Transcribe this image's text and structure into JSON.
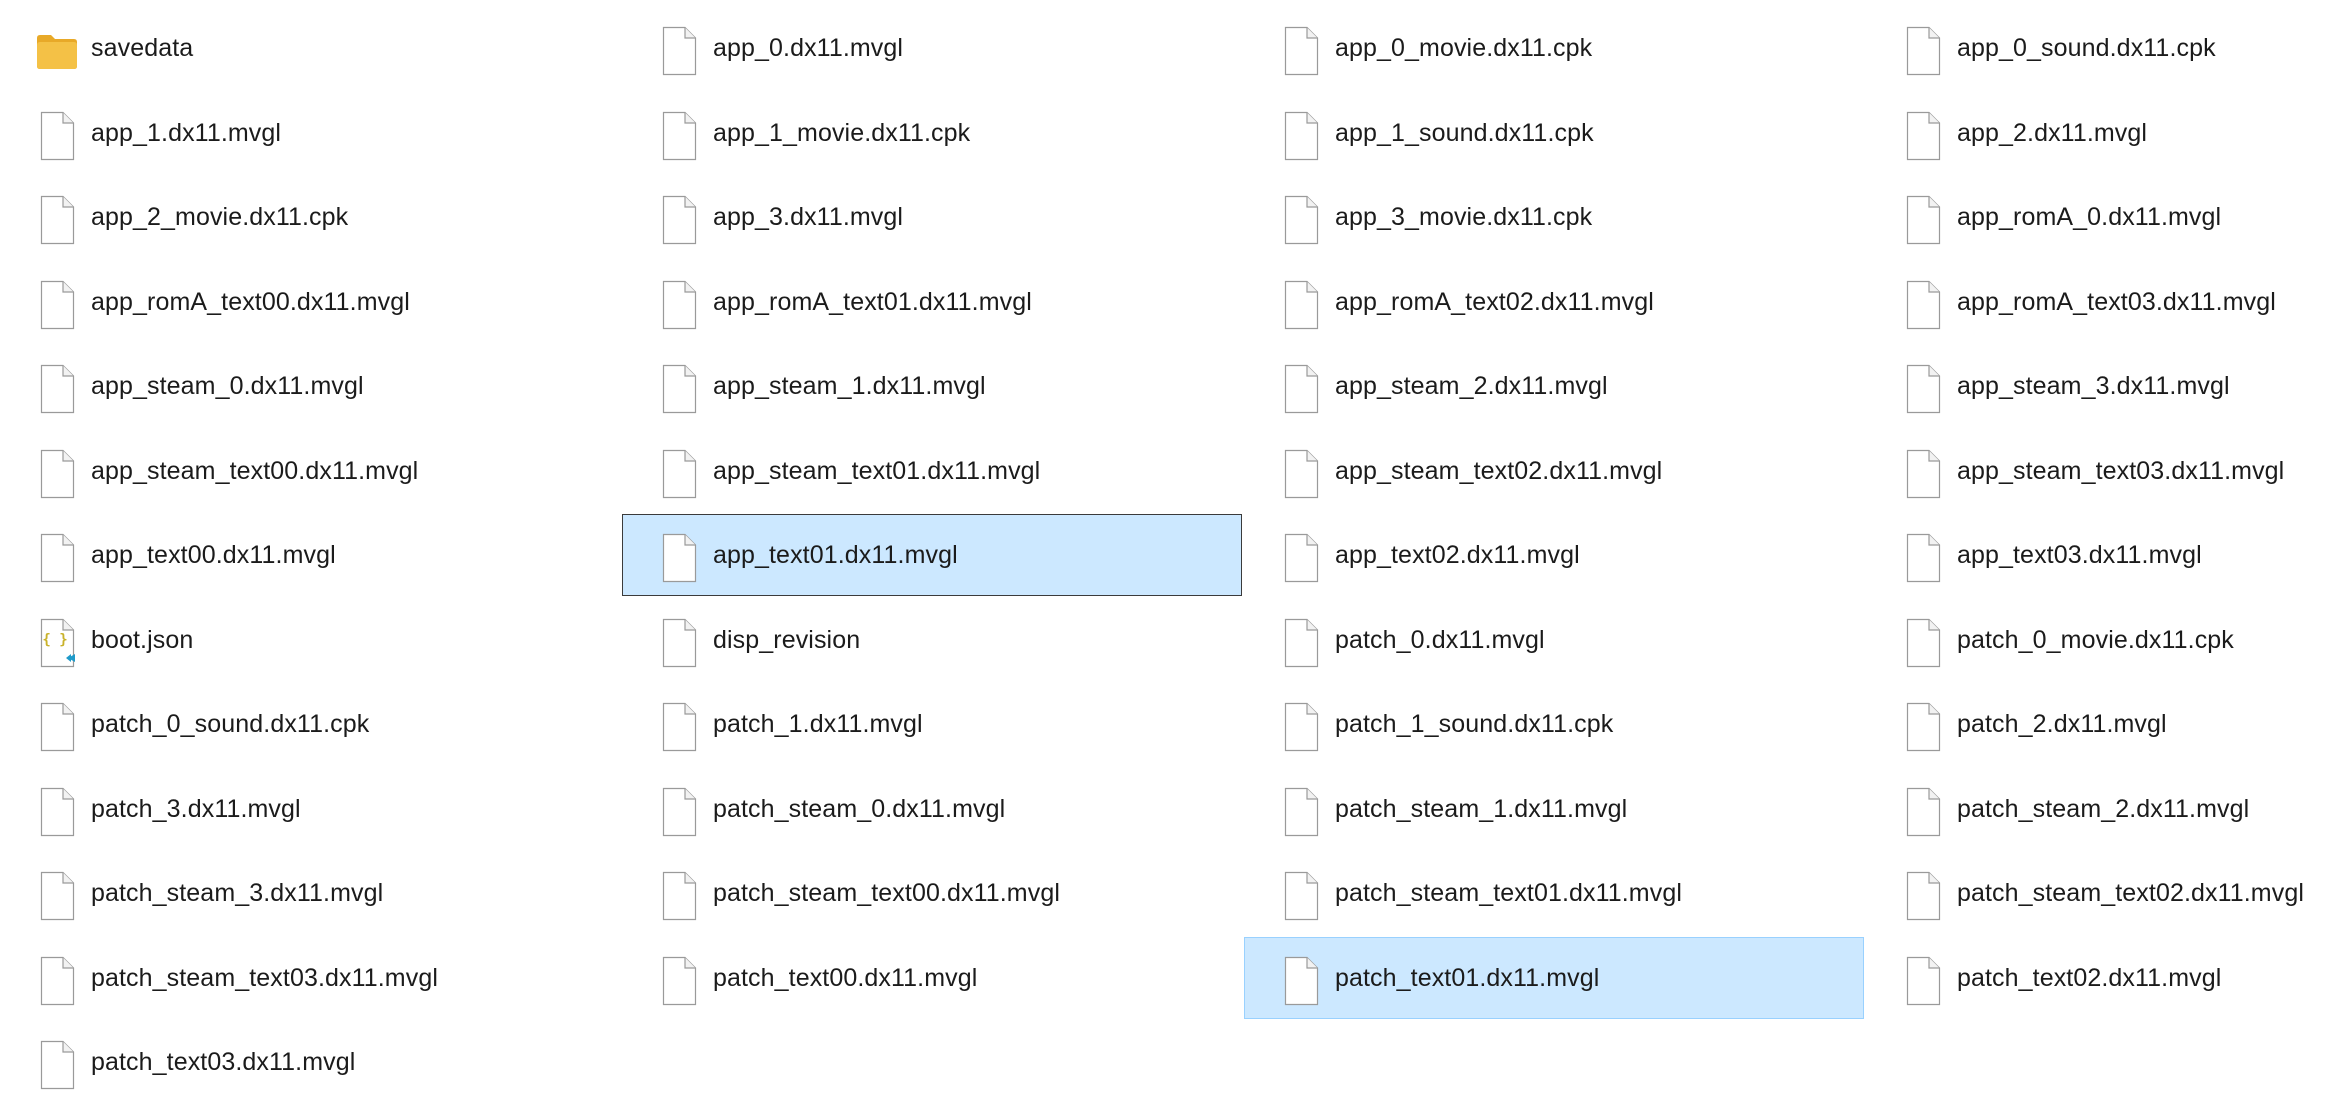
{
  "window": {
    "view": "Large icons",
    "colors": {
      "selection_fill": "#cce8ff",
      "selection_border_focused": "#3b3b3b",
      "selection_border_unfocused": "#99d1ff",
      "folder": "#f4c146",
      "json_braces": "#c9b22a",
      "json_badge": "#1f9ac9"
    }
  },
  "files": [
    {
      "name": "savedata",
      "icon": "folder-icon"
    },
    {
      "name": "app_0.dx11.mvgl",
      "icon": "file-icon"
    },
    {
      "name": "app_0_movie.dx11.cpk",
      "icon": "file-icon"
    },
    {
      "name": "app_0_sound.dx11.cpk",
      "icon": "file-icon"
    },
    {
      "name": "app_1.dx11.mvgl",
      "icon": "file-icon"
    },
    {
      "name": "app_1_movie.dx11.cpk",
      "icon": "file-icon"
    },
    {
      "name": "app_1_sound.dx11.cpk",
      "icon": "file-icon"
    },
    {
      "name": "app_2.dx11.mvgl",
      "icon": "file-icon"
    },
    {
      "name": "app_2_movie.dx11.cpk",
      "icon": "file-icon"
    },
    {
      "name": "app_3.dx11.mvgl",
      "icon": "file-icon"
    },
    {
      "name": "app_3_movie.dx11.cpk",
      "icon": "file-icon"
    },
    {
      "name": "app_romA_0.dx11.mvgl",
      "icon": "file-icon"
    },
    {
      "name": "app_romA_text00.dx11.mvgl",
      "icon": "file-icon"
    },
    {
      "name": "app_romA_text01.dx11.mvgl",
      "icon": "file-icon"
    },
    {
      "name": "app_romA_text02.dx11.mvgl",
      "icon": "file-icon"
    },
    {
      "name": "app_romA_text03.dx11.mvgl",
      "icon": "file-icon"
    },
    {
      "name": "app_steam_0.dx11.mvgl",
      "icon": "file-icon"
    },
    {
      "name": "app_steam_1.dx11.mvgl",
      "icon": "file-icon"
    },
    {
      "name": "app_steam_2.dx11.mvgl",
      "icon": "file-icon"
    },
    {
      "name": "app_steam_3.dx11.mvgl",
      "icon": "file-icon"
    },
    {
      "name": "app_steam_text00.dx11.mvgl",
      "icon": "file-icon"
    },
    {
      "name": "app_steam_text01.dx11.mvgl",
      "icon": "file-icon"
    },
    {
      "name": "app_steam_text02.dx11.mvgl",
      "icon": "file-icon"
    },
    {
      "name": "app_steam_text03.dx11.mvgl",
      "icon": "file-icon"
    },
    {
      "name": "app_text00.dx11.mvgl",
      "icon": "file-icon"
    },
    {
      "name": "app_text01.dx11.mvgl",
      "icon": "file-icon",
      "selected": true,
      "focused": true
    },
    {
      "name": "app_text02.dx11.mvgl",
      "icon": "file-icon"
    },
    {
      "name": "app_text03.dx11.mvgl",
      "icon": "file-icon"
    },
    {
      "name": "boot.json",
      "icon": "json-file-icon"
    },
    {
      "name": "disp_revision",
      "icon": "file-icon"
    },
    {
      "name": "patch_0.dx11.mvgl",
      "icon": "file-icon"
    },
    {
      "name": "patch_0_movie.dx11.cpk",
      "icon": "file-icon"
    },
    {
      "name": "patch_0_sound.dx11.cpk",
      "icon": "file-icon"
    },
    {
      "name": "patch_1.dx11.mvgl",
      "icon": "file-icon"
    },
    {
      "name": "patch_1_sound.dx11.cpk",
      "icon": "file-icon"
    },
    {
      "name": "patch_2.dx11.mvgl",
      "icon": "file-icon"
    },
    {
      "name": "patch_3.dx11.mvgl",
      "icon": "file-icon"
    },
    {
      "name": "patch_steam_0.dx11.mvgl",
      "icon": "file-icon"
    },
    {
      "name": "patch_steam_1.dx11.mvgl",
      "icon": "file-icon"
    },
    {
      "name": "patch_steam_2.dx11.mvgl",
      "icon": "file-icon"
    },
    {
      "name": "patch_steam_3.dx11.mvgl",
      "icon": "file-icon"
    },
    {
      "name": "patch_steam_text00.dx11.mvgl",
      "icon": "file-icon"
    },
    {
      "name": "patch_steam_text01.dx11.mvgl",
      "icon": "file-icon"
    },
    {
      "name": "patch_steam_text02.dx11.mvgl",
      "icon": "file-icon"
    },
    {
      "name": "patch_steam_text03.dx11.mvgl",
      "icon": "file-icon"
    },
    {
      "name": "patch_text00.dx11.mvgl",
      "icon": "file-icon"
    },
    {
      "name": "patch_text01.dx11.mvgl",
      "icon": "file-icon",
      "selected": true,
      "focused": false
    },
    {
      "name": "patch_text02.dx11.mvgl",
      "icon": "file-icon"
    },
    {
      "name": "patch_text03.dx11.mvgl",
      "icon": "file-icon"
    }
  ]
}
